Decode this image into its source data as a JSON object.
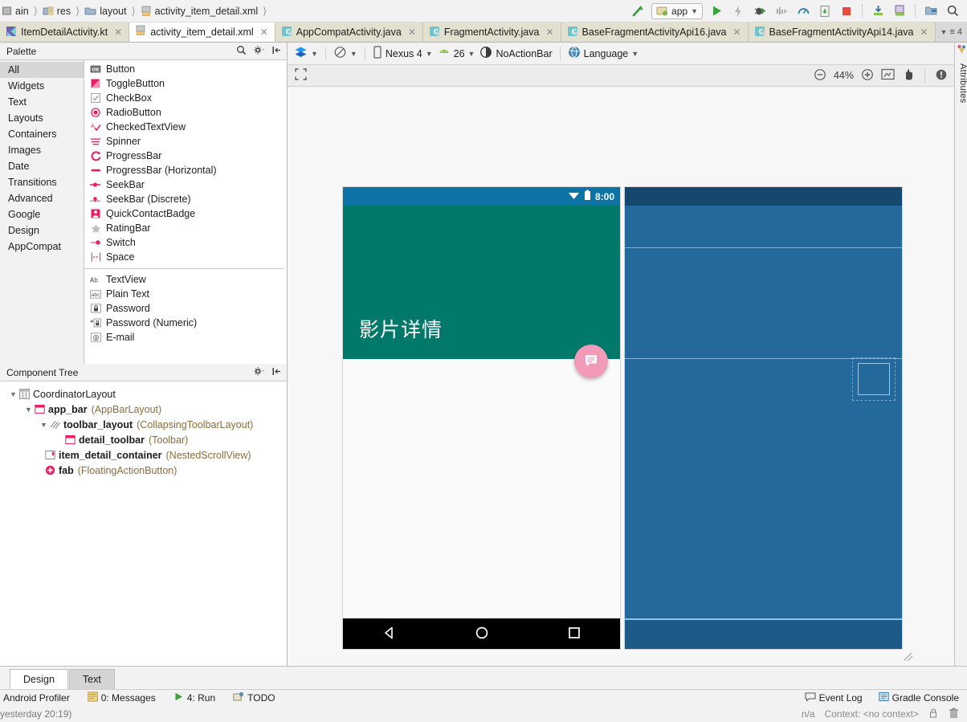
{
  "toolbar": {
    "breadcrumbs": [
      {
        "label": "ain",
        "icon": "module-icon"
      },
      {
        "label": "res",
        "icon": "res-folder-icon"
      },
      {
        "label": "layout",
        "icon": "folder-icon"
      },
      {
        "label": "activity_item_detail.xml",
        "icon": "xml-file-icon"
      }
    ],
    "run_config": "app",
    "actions": [
      "build-hammer-icon",
      "run-icon",
      "apply-changes-icon",
      "debug-icon",
      "step-icon",
      "profile-icon",
      "attach-debugger-icon",
      "stop-icon",
      "avd-manager-icon",
      "sdk-manager-icon",
      "project-structure-icon",
      "search-icon"
    ]
  },
  "editor_tabs": {
    "tabs": [
      {
        "label": "ItemDetailActivity.kt",
        "icon": "kotlin-file-icon",
        "active": false
      },
      {
        "label": "activity_item_detail.xml",
        "icon": "xml-layout-file-icon",
        "active": true
      },
      {
        "label": "AppCompatActivity.java",
        "icon": "java-class-icon",
        "active": false
      },
      {
        "label": "FragmentActivity.java",
        "icon": "java-class-icon",
        "active": false
      },
      {
        "label": "BaseFragmentActivityApi16.java",
        "icon": "java-class-icon",
        "active": false
      },
      {
        "label": "BaseFragmentActivityApi14.java",
        "icon": "java-class-icon",
        "active": false
      }
    ],
    "overflow_count": "4"
  },
  "palette": {
    "title": "Palette",
    "actions": [
      "search-icon",
      "gear-icon",
      "collapse-all-icon"
    ],
    "categories": [
      {
        "label": "All",
        "selected": true
      },
      {
        "label": "Widgets",
        "selected": false
      },
      {
        "label": "Text",
        "selected": false
      },
      {
        "label": "Layouts",
        "selected": false
      },
      {
        "label": "Containers",
        "selected": false
      },
      {
        "label": "Images",
        "selected": false
      },
      {
        "label": "Date",
        "selected": false
      },
      {
        "label": "Transitions",
        "selected": false
      },
      {
        "label": "Advanced",
        "selected": false
      },
      {
        "label": "Google",
        "selected": false
      },
      {
        "label": "Design",
        "selected": false
      },
      {
        "label": "AppCompat",
        "selected": false
      }
    ],
    "group1": [
      {
        "label": "Button",
        "icon": "button-icon"
      },
      {
        "label": "ToggleButton",
        "icon": "togglebutton-icon"
      },
      {
        "label": "CheckBox",
        "icon": "checkbox-icon"
      },
      {
        "label": "RadioButton",
        "icon": "radiobutton-icon"
      },
      {
        "label": "CheckedTextView",
        "icon": "checkedtextview-icon"
      },
      {
        "label": "Spinner",
        "icon": "spinner-icon"
      },
      {
        "label": "ProgressBar",
        "icon": "progressbar-icon"
      },
      {
        "label": "ProgressBar (Horizontal)",
        "icon": "progressbar-horizontal-icon"
      },
      {
        "label": "SeekBar",
        "icon": "seekbar-icon"
      },
      {
        "label": "SeekBar (Discrete)",
        "icon": "seekbar-discrete-icon"
      },
      {
        "label": "QuickContactBadge",
        "icon": "quickcontactbadge-icon"
      },
      {
        "label": "RatingBar",
        "icon": "ratingbar-icon"
      },
      {
        "label": "Switch",
        "icon": "switch-icon"
      },
      {
        "label": "Space",
        "icon": "space-icon"
      }
    ],
    "group2": [
      {
        "label": "TextView",
        "icon": "textview-icon"
      },
      {
        "label": "Plain Text",
        "icon": "plaintext-icon"
      },
      {
        "label": "Password",
        "icon": "password-icon"
      },
      {
        "label": "Password (Numeric)",
        "icon": "password-numeric-icon"
      },
      {
        "label": "E-mail",
        "icon": "email-icon"
      }
    ]
  },
  "component_tree": {
    "title": "Component Tree",
    "actions": [
      "gear-icon",
      "collapse-all-icon"
    ],
    "nodes": [
      {
        "indent": 0,
        "arrow": true,
        "icon": "coordinatorlayout-icon",
        "name": "CoordinatorLayout",
        "type": ""
      },
      {
        "indent": 1,
        "arrow": true,
        "icon": "appbarlayout-icon",
        "name": "app_bar",
        "type": "(AppBarLayout)"
      },
      {
        "indent": 2,
        "arrow": true,
        "icon": "collapsingtoolbar-icon",
        "name": "toolbar_layout",
        "type": "(CollapsingToolbarLayout)"
      },
      {
        "indent": 3,
        "arrow": false,
        "icon": "toolbar-icon",
        "name": "detail_toolbar",
        "type": "(Toolbar)"
      },
      {
        "indent": 1,
        "arrow": false,
        "icon": "nestedscrollview-icon",
        "name": "item_detail_container",
        "type": "(NestedScrollView)"
      },
      {
        "indent": 1,
        "arrow": false,
        "icon": "fab-icon",
        "name": "fab",
        "type": "(FloatingActionButton)"
      }
    ]
  },
  "design_toolbar": {
    "design_mode_icon": "layers-icon",
    "orientation_icon": "orientation-icon",
    "device": "Nexus 4",
    "device_icon": "phone-icon",
    "api": "26",
    "api_icon": "android-icon",
    "theme": "NoActionBar",
    "theme_icon": "theme-icon",
    "language": "Language",
    "language_icon": "globe-icon"
  },
  "zoom_bar": {
    "select_all_icon": "fit-selection-icon",
    "zoom_out_icon": "zoom-out-icon",
    "level": "44%",
    "zoom_in_icon": "zoom-in-icon",
    "fit_icon": "zoom-to-fit-icon",
    "pan_icon": "pan-hand-icon",
    "issues_icon": "warning-icon"
  },
  "preview": {
    "status_time": "8:00",
    "wifi_icon": "wifi-icon",
    "battery_icon": "battery-icon",
    "app_title": "影片详情",
    "fab_icon": "chat-bubble-icon",
    "nav_back_icon": "nav-back-triangle-icon",
    "nav_home_icon": "nav-home-circle-icon",
    "nav_recents_icon": "nav-recents-square-icon",
    "colors": {
      "status_bar": "#0d72a5",
      "app_bar": "#00796b",
      "fab": "#f29bb8",
      "content": "#fafafa",
      "nav_bar": "#000000",
      "blueprint_body": "#24699b",
      "blueprint_status": "#16476c",
      "blueprint_outline": "#8fc2e4"
    }
  },
  "right_strip": {
    "tab_label": "Attributes",
    "tab_icon": "attributes-icon"
  },
  "bottom_tabs": [
    {
      "label": "Design",
      "active": true
    },
    {
      "label": "Text",
      "active": false
    }
  ],
  "status_bar": {
    "left_items": [
      {
        "label": "Android Profiler",
        "icon": ""
      },
      {
        "label": "0: Messages",
        "icon": "messages-icon"
      },
      {
        "label": "4: Run",
        "icon": "run-green-icon"
      },
      {
        "label": "TODO",
        "icon": "todo-icon"
      }
    ],
    "right_items": [
      {
        "label": "Event Log",
        "icon": "event-log-icon"
      },
      {
        "label": "Gradle Console",
        "icon": "gradle-console-icon"
      }
    ],
    "message": "yesterday 20:19)",
    "encoding": "n/a",
    "context": "Context: <no context>",
    "lock_icon": "lock-icon",
    "trash_icon": "trash-icon"
  }
}
